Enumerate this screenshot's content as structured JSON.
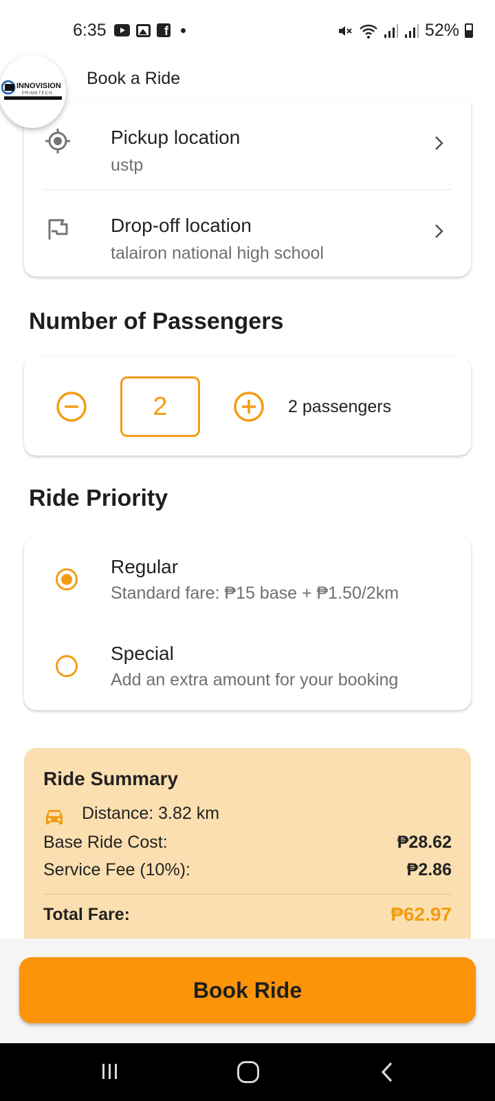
{
  "status_bar": {
    "time": "6:35",
    "battery": "52%"
  },
  "header": {
    "title": "Book a Ride",
    "logo_text": "INNOVISION",
    "logo_subtext": "PRIMETECH"
  },
  "locations": {
    "pickup": {
      "label": "Pickup location",
      "value": "ustp",
      "icon": "target-icon"
    },
    "dropoff": {
      "label": "Drop-off location",
      "value": "talairon national high school",
      "icon": "flag-icon"
    }
  },
  "passengers": {
    "section_title": "Number of Passengers",
    "count": "2",
    "label": "2 passengers"
  },
  "priority": {
    "section_title": "Ride Priority",
    "options": [
      {
        "title": "Regular",
        "description": "Standard fare: ₱15 base + ₱1.50/2km",
        "selected": true
      },
      {
        "title": "Special",
        "description": "Add an extra amount for your booking",
        "selected": false
      }
    ]
  },
  "summary": {
    "title": "Ride Summary",
    "distance": "Distance: 3.82 km",
    "base_label": "Base Ride Cost:",
    "base_value": "₱28.62",
    "fee_label": "Service Fee (10%):",
    "fee_value": "₱2.86",
    "total_label": "Total Fare:",
    "total_value": "₱62.97"
  },
  "actions": {
    "book_label": "Book Ride"
  },
  "colors": {
    "accent": "#f39c12",
    "button": "#fb9409",
    "summary_bg": "#fbdfb0"
  }
}
